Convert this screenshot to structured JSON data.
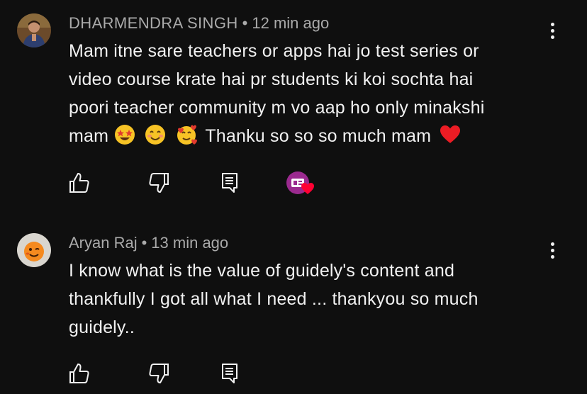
{
  "comments": [
    {
      "author": "DHARMENDRA SINGH",
      "time": "12 min ago",
      "lines": [
        "Mam itne sare teachers or apps hai jo test series or",
        "video course krate hai pr students ki koi sochta hai",
        "poori teacher community m vo aap ho only minakshi"
      ],
      "last_line_prefix": "mam",
      "last_line_suffix": "Thanku so so so much mam",
      "emojis": [
        "star-struck-emoji",
        "smiling-face-emoji",
        "smiling-face-with-hearts-emoji",
        "red-heart-emoji"
      ],
      "creator_hearted": true
    },
    {
      "author": "Aryan Raj",
      "time": "13 min ago",
      "lines": [
        "I know what is the value of guidely's content and",
        "thankfully I got all what I need ... thankyou so much",
        "guidely.."
      ],
      "creator_hearted": false
    }
  ],
  "colors": {
    "background": "#0f0f0f",
    "text": "#f1f1f1",
    "meta": "#aaaaaa",
    "heart": "#ff0033",
    "creator_avatar": "#9b2a8f"
  }
}
